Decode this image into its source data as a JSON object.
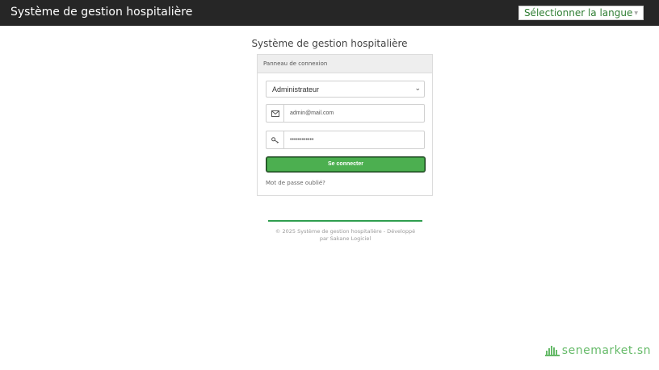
{
  "header": {
    "title": "Système de gestion hospitalière",
    "language_button": "Sélectionner la langue"
  },
  "page": {
    "heading": "Système de gestion hospitalière"
  },
  "login_panel": {
    "heading": "Panneau de connexion",
    "role_select": {
      "selected": "Administrateur"
    },
    "email": {
      "value": "admin@mail.com",
      "icon": "envelope-icon"
    },
    "password": {
      "value": "••••••••••••",
      "icon": "key-icon"
    },
    "submit_label": "Se connecter",
    "forgot_password": "Mot de passe oublié?"
  },
  "footer": {
    "line1": "© 2025 Système de gestion hospitalière - Développé",
    "line2": "par Sakane Logiciel"
  },
  "watermark": {
    "text": "senemarket.sn"
  },
  "colors": {
    "topbar": "#262626",
    "accent_green": "#4caf50",
    "language_text": "#2e7d32"
  }
}
